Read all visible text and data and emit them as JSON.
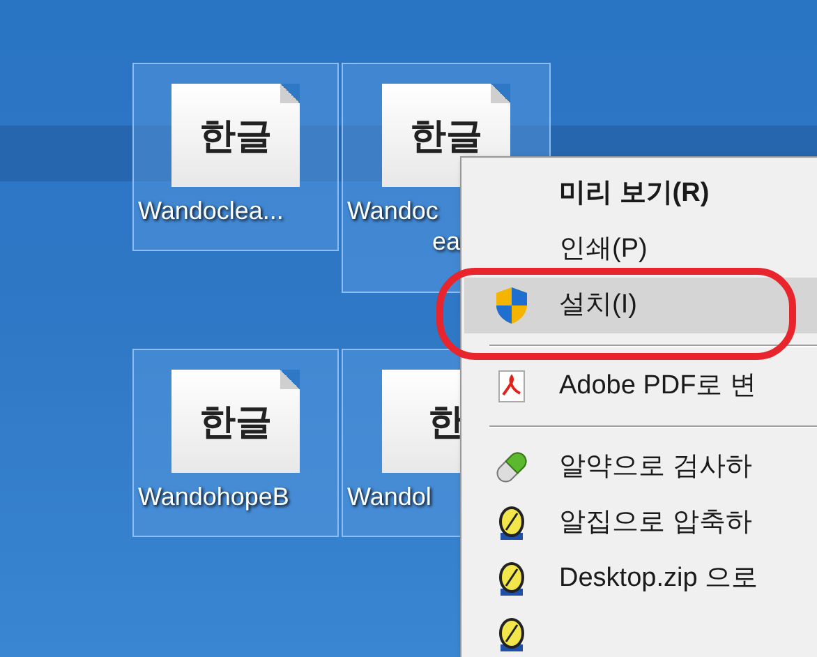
{
  "desktop_icons": [
    {
      "glyph": "한글",
      "label_lines": [
        "Wandoclea..."
      ],
      "selected": true
    },
    {
      "glyph": "한글",
      "label_lines": [
        "Wandoc",
        "ea"
      ],
      "selected": true
    },
    {
      "glyph": "한글",
      "label_lines": [
        "WandohopeB"
      ],
      "selected": true
    },
    {
      "glyph": "한",
      "label_lines": [
        "Wandol"
      ],
      "selected": true
    }
  ],
  "context_menu": {
    "items": [
      {
        "kind": "plain",
        "label": "미리 보기(R)",
        "default": true,
        "selected": false
      },
      {
        "kind": "plain",
        "label": "인쇄(P)",
        "default": false,
        "selected": false
      },
      {
        "kind": "shield",
        "label": "설치(I)",
        "default": false,
        "selected": true
      },
      {
        "kind": "separator"
      },
      {
        "kind": "pdf",
        "label": "Adobe PDF로 변",
        "default": false,
        "selected": false
      },
      {
        "kind": "separator"
      },
      {
        "kind": "pill",
        "label": "알약으로 검사하",
        "default": false,
        "selected": false
      },
      {
        "kind": "zip",
        "label": "알집으로 압축하",
        "default": false,
        "selected": false
      },
      {
        "kind": "zip",
        "label": "Desktop.zip 으로",
        "default": false,
        "selected": false
      },
      {
        "kind": "zip",
        "selected": false
      }
    ]
  }
}
